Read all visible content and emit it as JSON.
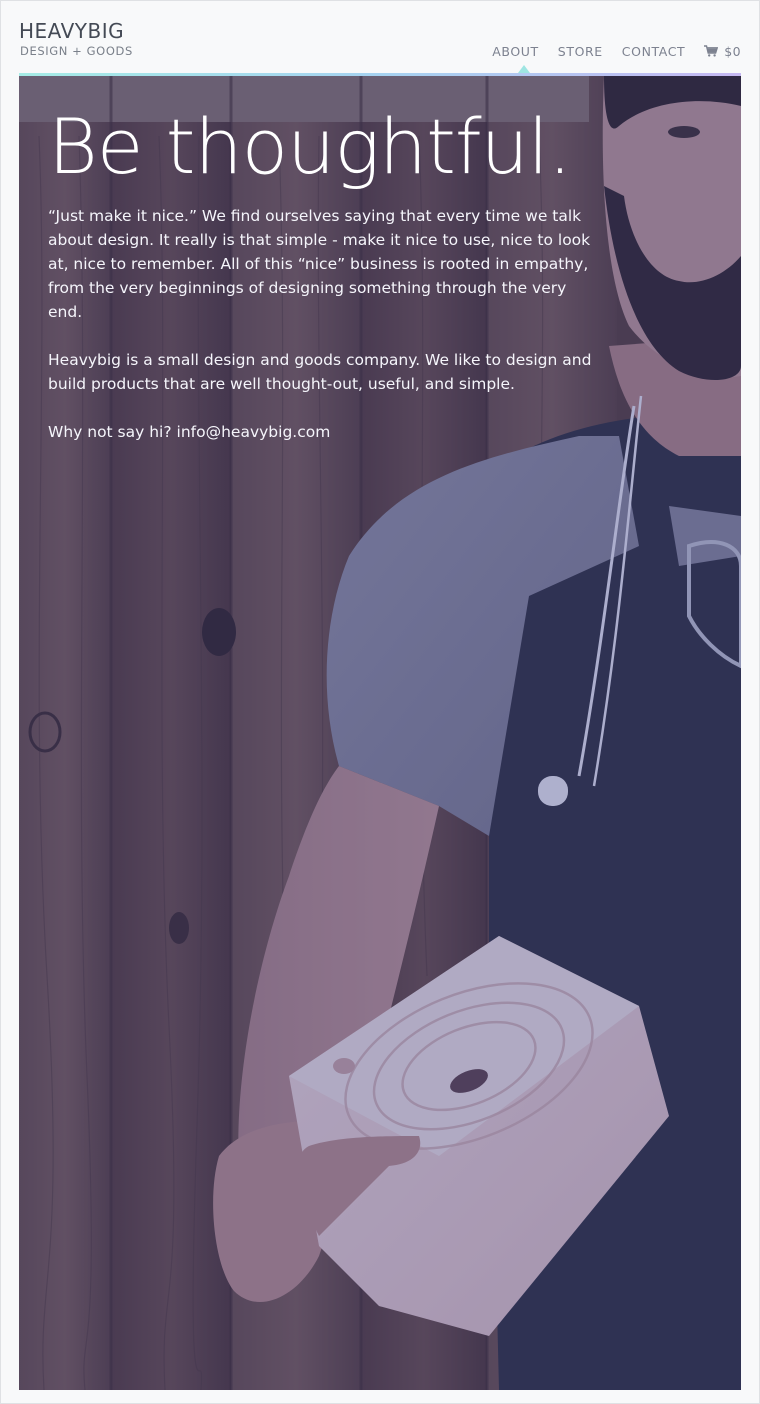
{
  "site": {
    "name": "HEAVYBIG",
    "tagline": "DESIGN + GOODS"
  },
  "nav": {
    "items": [
      {
        "label": "ABOUT",
        "active": true
      },
      {
        "label": "STORE",
        "active": false
      },
      {
        "label": "CONTACT",
        "active": false
      }
    ],
    "cart": {
      "icon": "cart-icon",
      "total": "$0"
    }
  },
  "hero": {
    "title": "Be thoughtful.",
    "paragraph_1": "“Just make it nice.” We find ourselves saying that every time we talk about design. It really is that simple - make it nice to use, nice to look at, nice to remember. All of this “nice” business is rooted in empathy, from the very beginnings of designing something through the very end.",
    "paragraph_2": "Heavybig is a small design and goods company. We like to design and build products that are well thought-out, useful, and simple.",
    "contact_prefix": "Why not say hi? ",
    "email": "info@heavybig.com"
  },
  "colors": {
    "accent_rule": "#a6ece6",
    "photo_tint": "#363c84",
    "text_muted": "#7d8290"
  }
}
